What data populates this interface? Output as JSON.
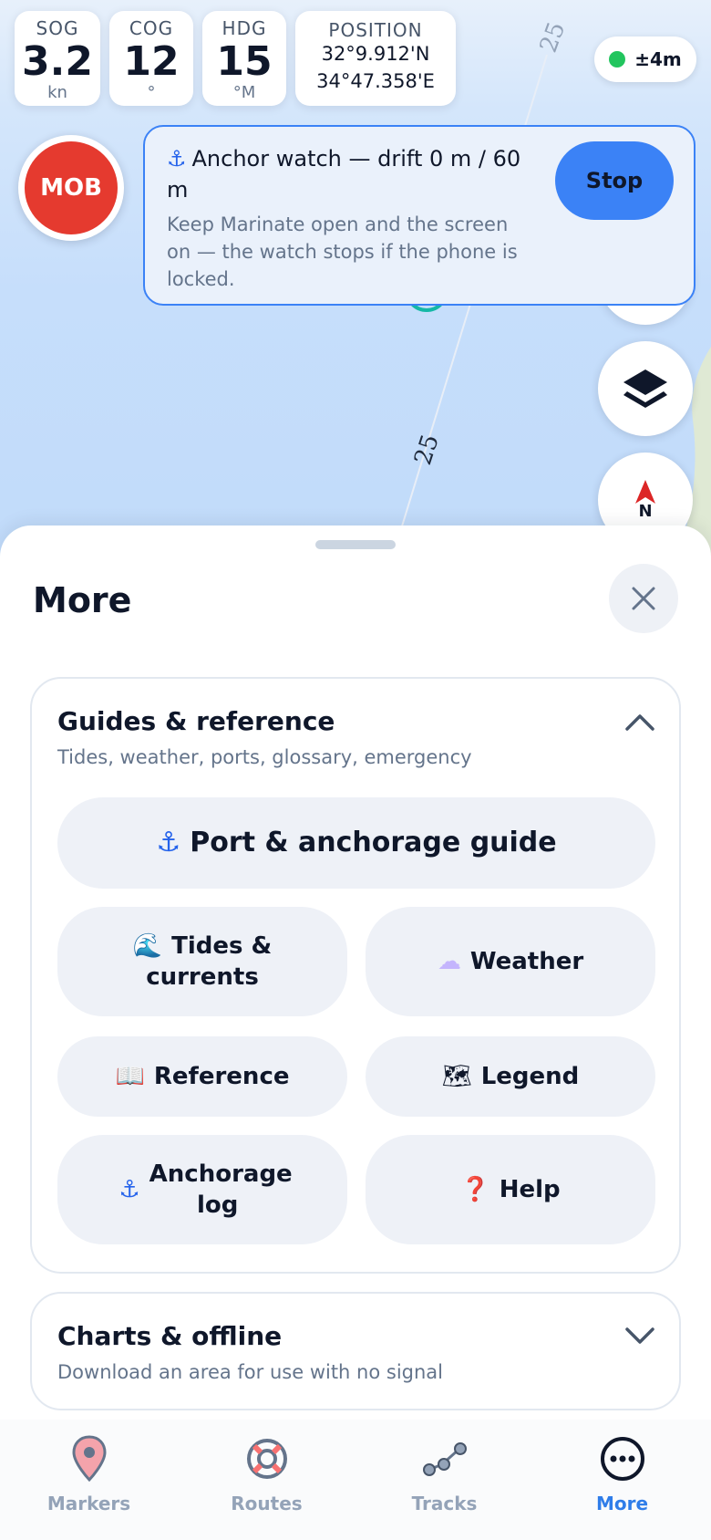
{
  "instruments": {
    "sog": {
      "label": "SOG",
      "value": "3.2",
      "unit": "kn"
    },
    "cog": {
      "label": "COG",
      "value": "12",
      "unit": "°"
    },
    "hdg": {
      "label": "HDG",
      "value": "15",
      "unit": "°M"
    },
    "position": {
      "label": "POSITION",
      "lat": "32°9.912'N",
      "lon": "34°47.358'E"
    }
  },
  "gps": {
    "accuracy": "±4m",
    "status_color": "#22c55e"
  },
  "map": {
    "depth_labels": [
      "25",
      "25"
    ]
  },
  "mob": {
    "label": "MOB",
    "color": "#e53a2f"
  },
  "anchor_watch": {
    "title": "Anchor watch — drift 0 m / 60 m",
    "subtitle": "Keep Marinate open and the screen on — the watch stops if the phone is locked.",
    "stop_label": "Stop",
    "accent": "#3b82f6"
  },
  "sheet": {
    "title": "More",
    "guides": {
      "title": "Guides & reference",
      "subtitle": "Tides, weather, ports, glossary, emergency",
      "buttons": [
        {
          "icon": "anchor-icon",
          "glyph": "⚓",
          "label": "Port & anchorage guide"
        },
        {
          "icon": "wave-icon",
          "glyph": "🌊",
          "label": "Tides & currents"
        },
        {
          "icon": "cloud-icon",
          "glyph": "☁",
          "label": "Weather"
        },
        {
          "icon": "book-icon",
          "glyph": "📖",
          "label": "Reference"
        },
        {
          "icon": "map-icon",
          "glyph": "🗺",
          "label": "Legend"
        },
        {
          "icon": "anchor-icon",
          "glyph": "⚓",
          "label": "Anchorage log"
        },
        {
          "icon": "question-icon",
          "glyph": "❓",
          "label": "Help"
        }
      ]
    },
    "charts": {
      "title": "Charts & offline",
      "subtitle": "Download an area for use with no signal"
    }
  },
  "nav": {
    "items": [
      {
        "label": "Markers",
        "icon": "pin-icon"
      },
      {
        "label": "Routes",
        "icon": "lifebuoy-icon"
      },
      {
        "label": "Tracks",
        "icon": "track-icon"
      },
      {
        "label": "More",
        "icon": "more-icon"
      }
    ],
    "active": "More",
    "active_color": "#2f7de9"
  }
}
